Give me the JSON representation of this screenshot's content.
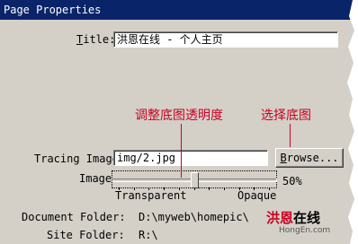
{
  "window": {
    "title": "Page Properties"
  },
  "title_field": {
    "label": "Title:",
    "value": "洪恩在线 - 个人主页"
  },
  "tracing_image": {
    "label": "Tracing Image:",
    "value": "img/2.jpg",
    "browse_label": "Browse..."
  },
  "opacity": {
    "label": "Image",
    "value": 50,
    "value_text": "50%",
    "min_label": "Transparent",
    "max_label": "Opaque"
  },
  "document_folder": {
    "label": "Document Folder:",
    "value": "D:\\myweb\\homepic\\"
  },
  "site_folder": {
    "label": "Site Folder:",
    "value": "R:\\"
  },
  "annotations": {
    "slider_note": "调整底图透明度",
    "browse_note": "选择底图"
  },
  "watermark": {
    "main": "洪恩在线",
    "sub": "HongEn.com"
  },
  "colors": {
    "titlebar": "#0a246a",
    "dialog": "#d4d0c8",
    "annotation": "#cc0022"
  }
}
